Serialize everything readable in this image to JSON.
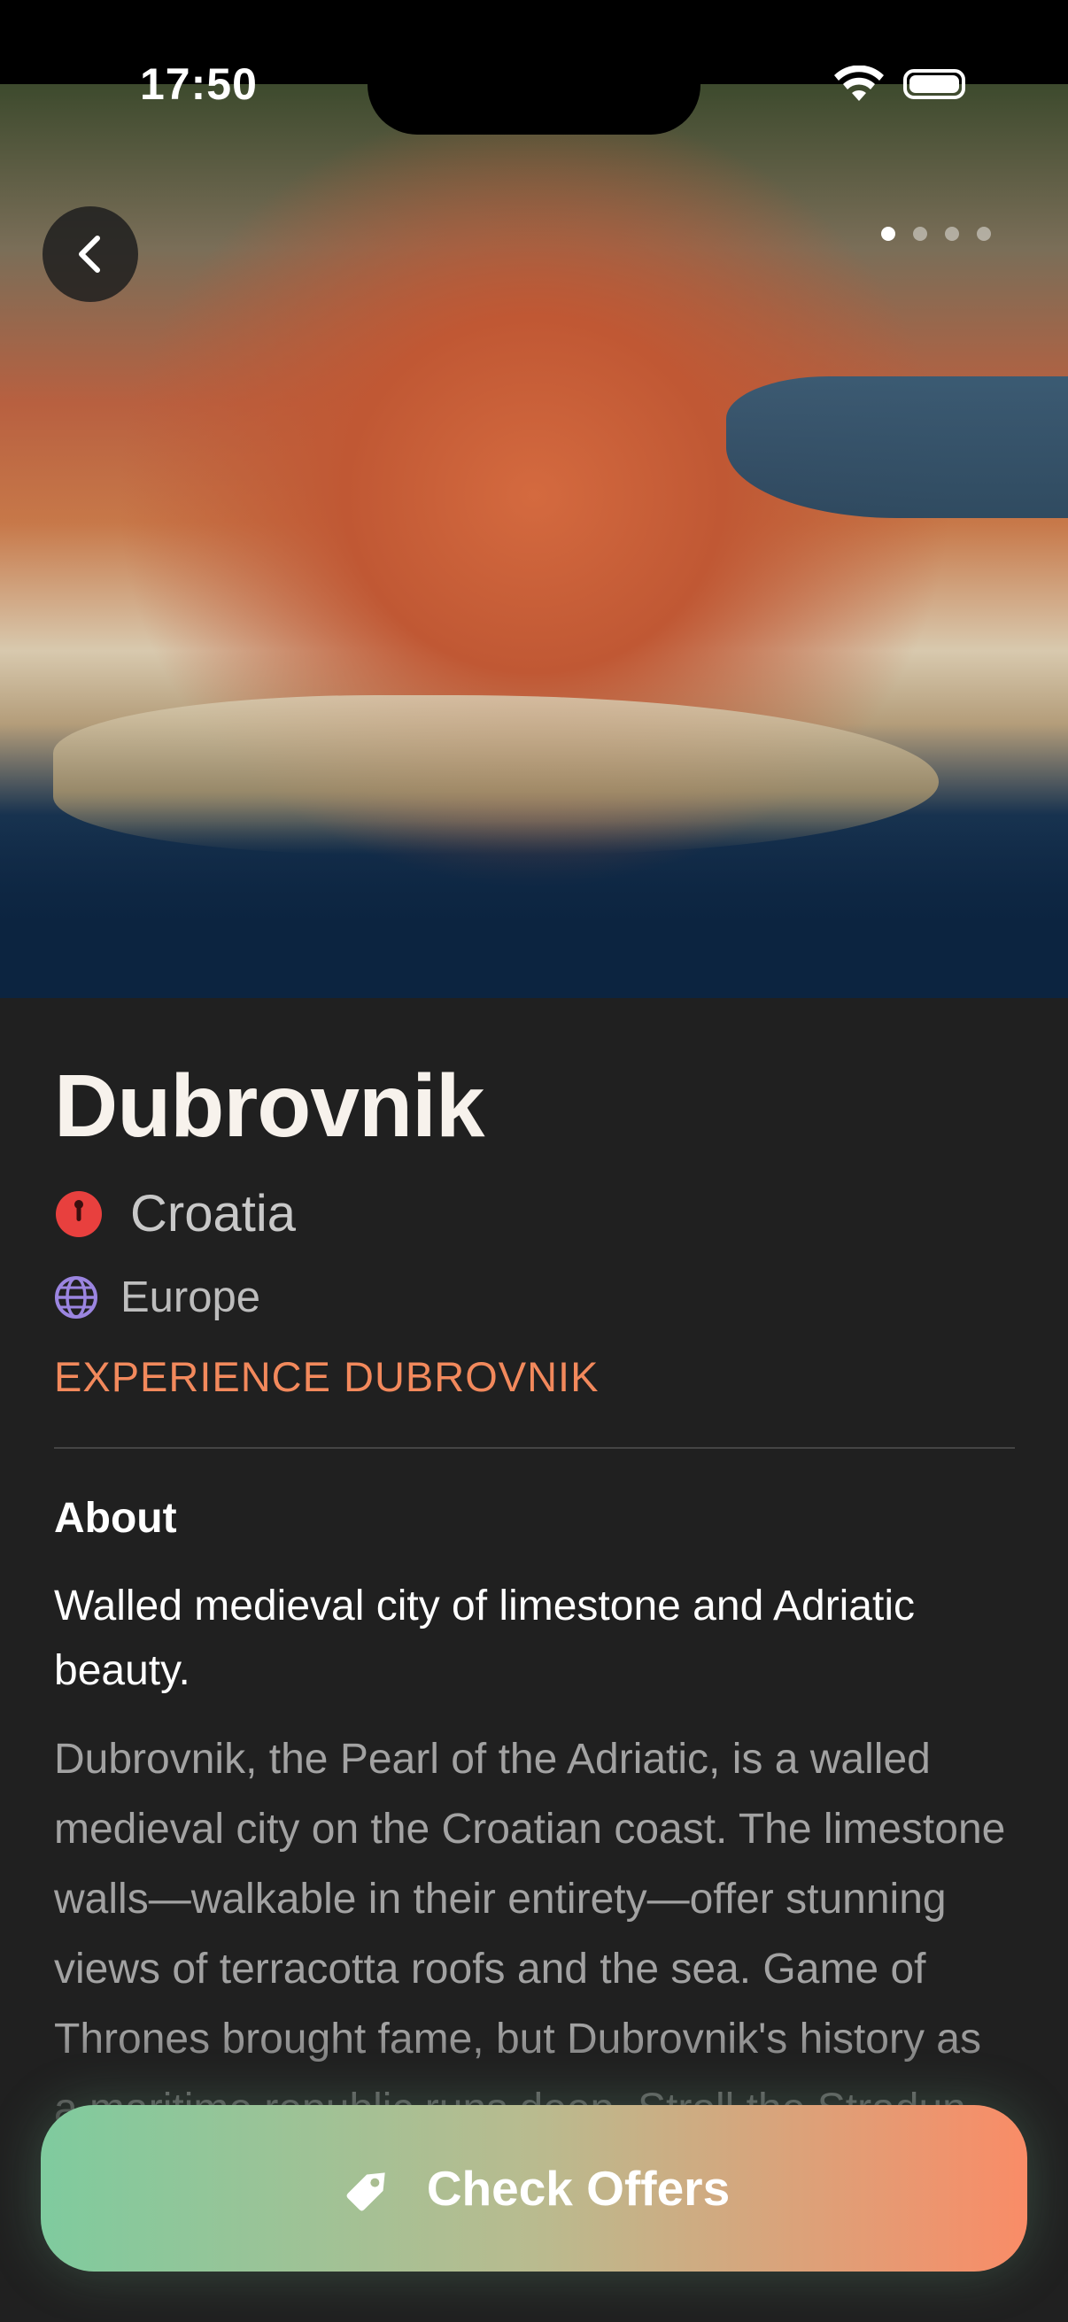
{
  "status_bar": {
    "time": "17:50"
  },
  "hero": {
    "page_count": 4,
    "active_page": 1
  },
  "destination": {
    "name": "Dubrovnik",
    "country": "Croatia",
    "region": "Europe",
    "experience_link": "EXPERIENCE DUBROVNIK"
  },
  "about": {
    "heading": "About",
    "tagline": "Walled medieval city of limestone and Adriatic beauty.",
    "description": "Dubrovnik, the Pearl of the Adriatic, is a walled medieval city on the Croatian coast. The limestone walls—walkable in their entirety—offer stunning views of terracotta roofs and the sea. Game of Thrones brought fame, but Dubrovnik's history as a maritime republic runs deep. Stroll the Stradun, admire the Renaissance and Baroque splendor. Swimming"
  },
  "cta": {
    "label": "Check Offers"
  },
  "colors": {
    "accent": "#f2895c",
    "background": "#202020",
    "pin": "#e8403e",
    "globe": "#9b85e0"
  }
}
